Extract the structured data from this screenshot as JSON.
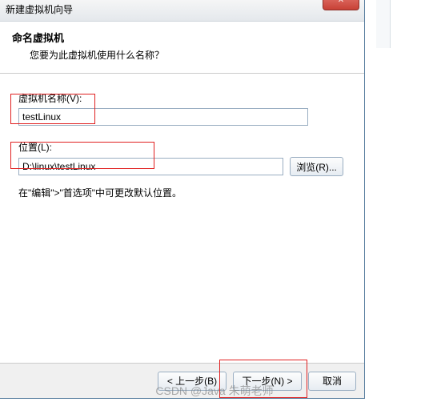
{
  "window": {
    "title": "新建虚拟机向导",
    "close_glyph": "✕"
  },
  "header": {
    "title": "命名虚拟机",
    "subtitle": "您要为此虚拟机使用什么名称？"
  },
  "fields": {
    "name_label": "虚拟机名称(V):",
    "name_value": "testLinux",
    "location_label": "位置(L):",
    "location_value": "D:\\linux\\testLinux",
    "browse_label": "浏览(R)...",
    "hint": "在\"编辑\">\"首选项\"中可更改默认位置。"
  },
  "footer": {
    "back": "< 上一步(B)",
    "next": "下一步(N) >",
    "cancel": "取消"
  },
  "watermark": "CSDN @Java 朱萌老师"
}
